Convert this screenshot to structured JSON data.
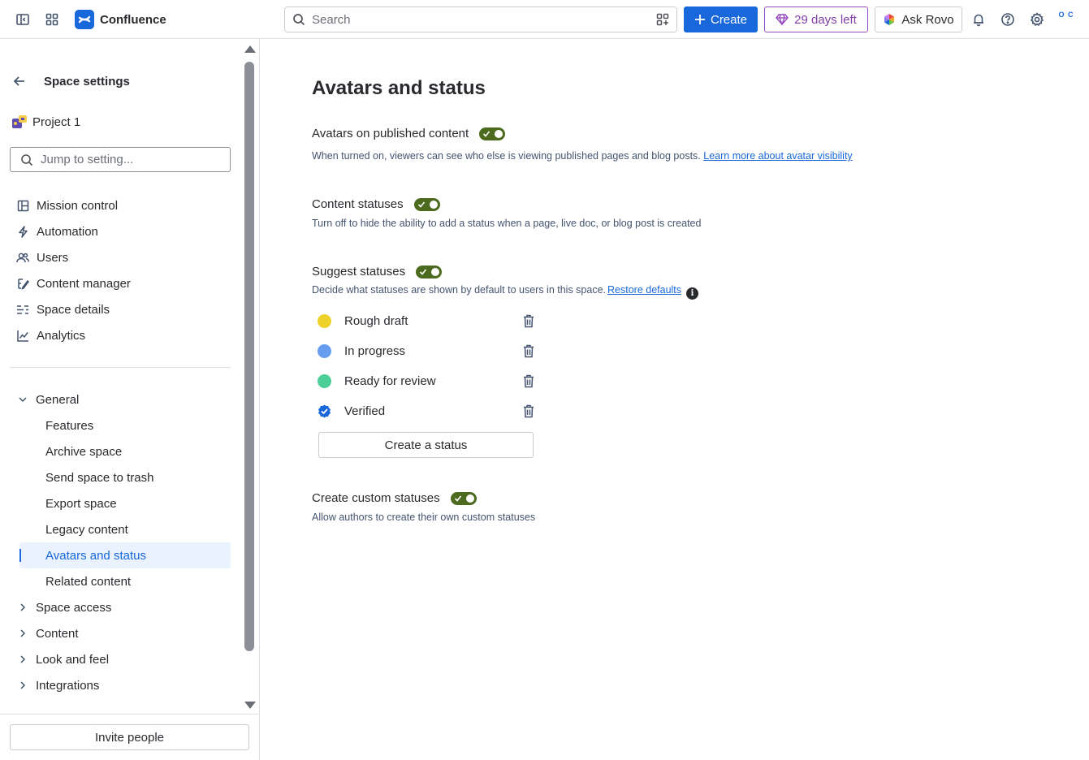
{
  "topbar": {
    "app_name": "Confluence",
    "search_placeholder": "Search",
    "create_label": "Create",
    "trial_label": "29 days left",
    "rovo_label": "Ask Rovo",
    "avatar_initials": "O C"
  },
  "sidebar": {
    "back_title": "Space settings",
    "project_name": "Project 1",
    "jump_placeholder": "Jump to setting...",
    "nav": [
      {
        "label": "Mission control",
        "icon": "layout-icon"
      },
      {
        "label": "Automation",
        "icon": "lightning-icon"
      },
      {
        "label": "Users",
        "icon": "people-icon"
      },
      {
        "label": "Content manager",
        "icon": "content-manager-icon"
      },
      {
        "label": "Space details",
        "icon": "sliders-icon"
      },
      {
        "label": "Analytics",
        "icon": "chart-icon"
      }
    ],
    "general": {
      "label": "General",
      "items": [
        "Features",
        "Archive space",
        "Send space to trash",
        "Export space",
        "Legacy content",
        "Avatars and status",
        "Related content"
      ],
      "active": "Avatars and status"
    },
    "groups": [
      "Space access",
      "Content",
      "Look and feel",
      "Integrations"
    ],
    "invite_label": "Invite people"
  },
  "main": {
    "title": "Avatars and status",
    "avatars": {
      "label": "Avatars on published content",
      "enabled": true,
      "desc": "When turned on, viewers can see who else is viewing published pages and blog posts.",
      "link": "Learn more about avatar visibility"
    },
    "content_statuses": {
      "label": "Content statuses",
      "enabled": true,
      "desc": "Turn off to hide the ability to add a status when a page, live doc, or blog post is created"
    },
    "suggest_statuses": {
      "label": "Suggest statuses",
      "enabled": true,
      "desc": "Decide what statuses are shown by default to users in this space.",
      "restore_label": "Restore defaults",
      "statuses": [
        {
          "label": "Rough draft",
          "color": "#eed12b"
        },
        {
          "label": "In progress",
          "color": "#669df1"
        },
        {
          "label": "Ready for review",
          "color": "#4bce97"
        },
        {
          "label": "Verified",
          "color": "#1868db"
        }
      ],
      "create_label": "Create a status"
    },
    "custom_statuses": {
      "label": "Create custom statuses",
      "enabled": true,
      "desc": "Allow authors to create their own custom statuses"
    }
  },
  "colors": {
    "brand": "#1868db",
    "toggle_on": "#4c6b1f",
    "trial": "#964ac0"
  }
}
